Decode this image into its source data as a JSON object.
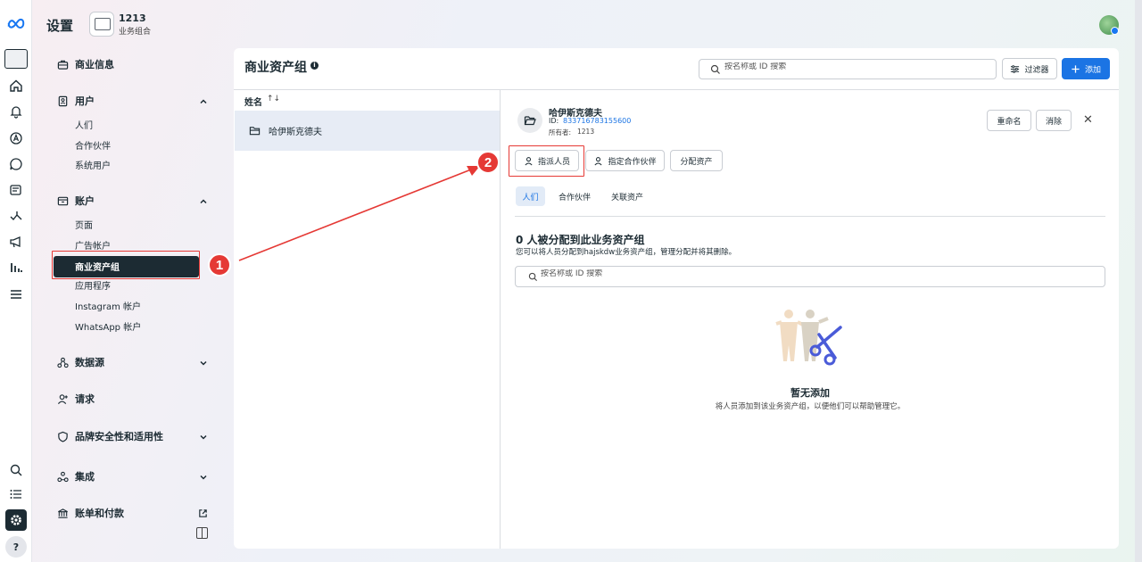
{
  "header": {
    "title": "设置",
    "business_name": "1213",
    "business_subtitle": "业务组合"
  },
  "nav": {
    "business_info": "商业信息",
    "users": "用户",
    "users_items": [
      "人们",
      "合作伙伴",
      "系统用户"
    ],
    "accounts": "账户",
    "accounts_items": [
      "页面",
      "广告帐户",
      "商业资产组",
      "应用程序",
      "Instagram 帐户",
      "WhatsApp 帐户"
    ],
    "data_sources": "数据源",
    "requests": "请求",
    "brand_safety": "品牌安全性和适用性",
    "integrations": "集成",
    "billing": "账单和付款"
  },
  "main": {
    "title": "商业资产组",
    "search_placeholder": "按名称或 ID 搜索",
    "filter_label": "过滤器",
    "add_label": "添加",
    "list_header": "姓名",
    "sort_glyph": "↑↓",
    "list_items": [
      "哈伊斯克德夫"
    ]
  },
  "detail": {
    "name": "哈伊斯克德夫",
    "id_label": "ID:",
    "id_value": "833716783155600",
    "owner_label": "所有者:",
    "owner_value": "1213",
    "rename_label": "重命名",
    "delete_label": "消除",
    "assign_people_label": "指派人员",
    "assign_partner_label": "指定合作伙伴",
    "assign_assets_label": "分配资产",
    "tabs": [
      "人们",
      "合作伙伴",
      "关联资产"
    ],
    "empty_title": "0 人被分配到此业务资产组",
    "empty_sub": "您可以将人员分配到hajskdw业务资产组，管理分配并将其删除。",
    "search_placeholder": "按名称或 ID 搜索",
    "none_title": "暂无添加",
    "none_sub": "将人员添加到该业务资产组，以便他们可以帮助管理它。"
  },
  "annotations": {
    "badge_1": "1",
    "badge_2": "2",
    "color": "#e53935"
  },
  "colors": {
    "accent": "#1b74e4",
    "dark": "#1c2b33"
  }
}
